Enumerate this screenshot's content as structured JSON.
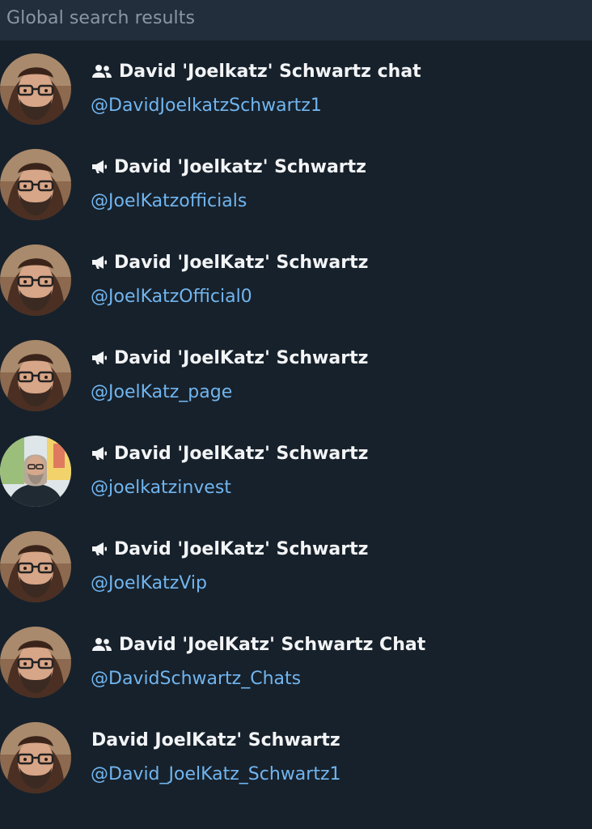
{
  "header": {
    "title": "Global search results"
  },
  "colors": {
    "background": "#17212b",
    "header_background": "#232e3c",
    "header_text": "#8a96a3",
    "name_text": "#f2f4f6",
    "username_text": "#71b5ef"
  },
  "results": [
    {
      "type_icon": "group-icon",
      "name": "David 'Joelkatz' Schwartz chat",
      "username": "@DavidJoelkatzSchwartz1",
      "avatar": "bearded-man-glasses-avatar"
    },
    {
      "type_icon": "channel-megaphone-icon",
      "name": "David 'Joelkatz' Schwartz",
      "username": "@JoelKatzofficials",
      "avatar": "bearded-man-glasses-avatar"
    },
    {
      "type_icon": "channel-megaphone-icon",
      "name": "David 'JoelKatz' Schwartz",
      "username": "@JoelKatzOfficial0",
      "avatar": "bearded-man-glasses-avatar"
    },
    {
      "type_icon": "channel-megaphone-icon",
      "name": "David 'JoelKatz' Schwartz",
      "username": "@JoelKatz_page",
      "avatar": "bearded-man-glasses-avatar"
    },
    {
      "type_icon": "channel-megaphone-icon",
      "name": "David 'JoelKatz' Schwartz",
      "username": "@joelkatzinvest",
      "avatar": "man-outdoor-photo-avatar"
    },
    {
      "type_icon": "channel-megaphone-icon",
      "name": "David 'JoelKatz' Schwartz",
      "username": "@JoelKatzVip",
      "avatar": "bearded-man-glasses-avatar"
    },
    {
      "type_icon": "group-icon",
      "name": "David 'JoelKatz' Schwartz Chat",
      "username": "@DavidSchwartz_Chats",
      "avatar": "bearded-man-glasses-avatar"
    },
    {
      "type_icon": "",
      "name": "David JoelKatz' Schwartz",
      "username": "@David_JoelKatz_Schwartz1",
      "avatar": "bearded-man-glasses-avatar"
    }
  ]
}
